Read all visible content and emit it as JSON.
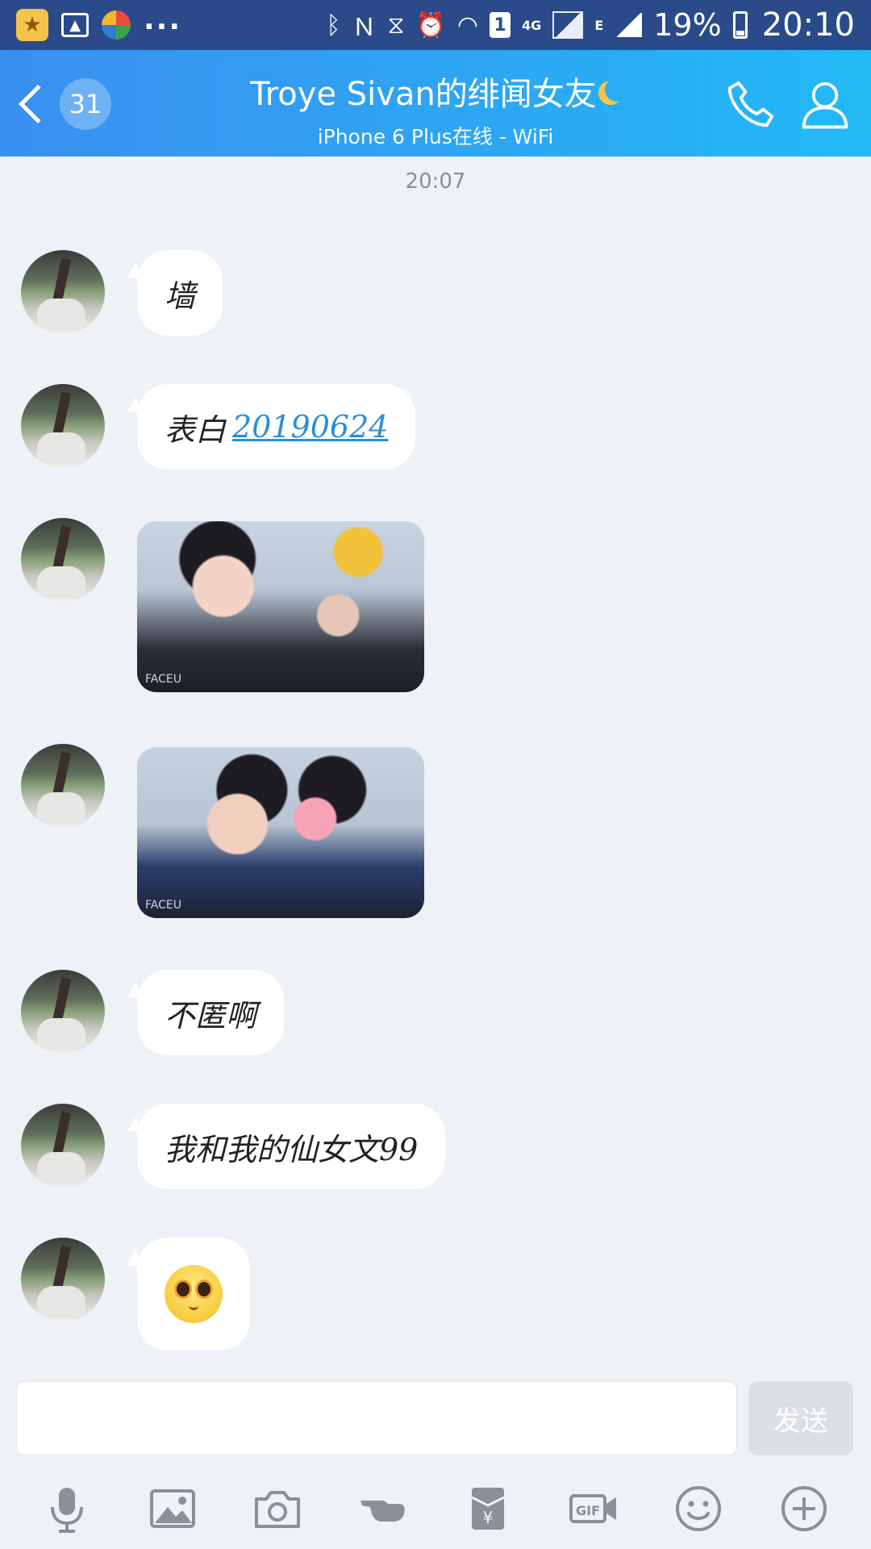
{
  "status_bar": {
    "time": "20:10",
    "battery": "19%",
    "more": "...",
    "network_4g": "4G",
    "network_e": "E",
    "sim": "1"
  },
  "header": {
    "unread_count": "31",
    "title": "Troye Sivan的绯闻女友",
    "subtitle": "iPhone 6 Plus在线 - WiFi"
  },
  "chat": {
    "timestamp": "20:07",
    "messages": [
      {
        "type": "text",
        "text": "墙"
      },
      {
        "type": "text",
        "text": "表白",
        "link": "20190624"
      },
      {
        "type": "image",
        "watermark": "FACEU"
      },
      {
        "type": "image",
        "watermark": "FACEU"
      },
      {
        "type": "text",
        "text": "不匿啊"
      },
      {
        "type": "text",
        "text": "我和我的仙女文99"
      },
      {
        "type": "emoji",
        "icon": "shy-face-emoji"
      }
    ]
  },
  "input": {
    "placeholder": "",
    "value": "",
    "send_label": "发送"
  },
  "toolbar": {
    "items": [
      "microphone-icon",
      "image-icon",
      "camera-icon",
      "poke-icon",
      "red-packet-icon",
      "gif-icon",
      "emoji-icon",
      "plus-icon"
    ]
  },
  "colors": {
    "header_start": "#3a8ff0",
    "header_end": "#23b9f6",
    "status_bar": "#2b4a8a",
    "background": "#eef1f6",
    "link": "#2a8ed8"
  }
}
